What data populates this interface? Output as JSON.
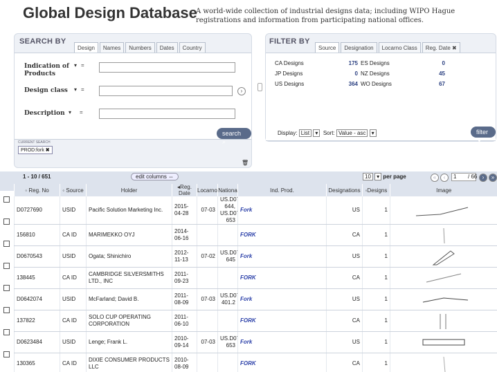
{
  "header": {
    "title": "Global Design Database",
    "tagline": "A world-wide collection of industrial designs data; including WIPO Hague registrations and information from participating national offices."
  },
  "search": {
    "title": "SEARCH BY",
    "tabs": [
      "Design",
      "Names",
      "Numbers",
      "Dates",
      "Country"
    ],
    "fields": [
      {
        "label": "Indication of Products",
        "op": "="
      },
      {
        "label": "Design class",
        "op": "="
      },
      {
        "label": "Description",
        "op": "="
      }
    ],
    "button": "search",
    "current_label": "CURRENT SEARCH",
    "current_tag": "PROD:fork"
  },
  "filter": {
    "title": "FILTER BY",
    "tabs": [
      "Source",
      "Designation",
      "Locarno Class",
      "Reg. Date"
    ],
    "sources": [
      {
        "name": "CA Designs",
        "count": "175"
      },
      {
        "name": "ES Designs",
        "count": "0"
      },
      {
        "name": "JP Designs",
        "count": "0"
      },
      {
        "name": "NZ Designs",
        "count": "45"
      },
      {
        "name": "US Designs",
        "count": "364"
      },
      {
        "name": "WO Designs",
        "count": "67"
      }
    ],
    "display_label": "Display:",
    "display_value": "List",
    "sort_label": "Sort:",
    "sort_value": "Value - asc",
    "button": "filter"
  },
  "results": {
    "range": "1 - 10 / 651",
    "edit_columns": "edit columns",
    "per_page_value": "10",
    "per_page_label": "per page",
    "page": "1",
    "pages": "/ 66"
  },
  "columns": [
    "Reg. No",
    "Source",
    "Holder",
    "Reg. Date",
    "Locarno",
    "Nationa",
    "Ind. Prod.",
    "Designations",
    "Designs",
    "Image"
  ],
  "rows": [
    {
      "reg": "D0727690",
      "src": "USID",
      "holder": "Pacific Solution Marketing Inc.",
      "date": "2015-04-28",
      "loc": "07-03",
      "nat": "US.D07-644, US.D07-653",
      "prod": "Fork",
      "desig": "US",
      "n": "1"
    },
    {
      "reg": "156810",
      "src": "CA ID",
      "holder": "MARIMEKKO OYJ",
      "date": "2014-06-16",
      "loc": "",
      "nat": "",
      "prod": "FORK",
      "desig": "CA",
      "n": "1"
    },
    {
      "reg": "D0670543",
      "src": "USID",
      "holder": "Ogata; Shinichiro",
      "date": "2012-11-13",
      "loc": "07-02",
      "nat": "US.D07-645",
      "prod": "Fork",
      "desig": "US",
      "n": "1"
    },
    {
      "reg": "138445",
      "src": "CA ID",
      "holder": "CAMBRIDGE SILVERSMITHS LTD., INC",
      "date": "2011-09-23",
      "loc": "",
      "nat": "",
      "prod": "FORK",
      "desig": "CA",
      "n": "1"
    },
    {
      "reg": "D0642074",
      "src": "USID",
      "holder": "McFarland; David B.",
      "date": "2011-08-09",
      "loc": "07-03",
      "nat": "US.D07-401.2",
      "prod": "Fork",
      "desig": "US",
      "n": "1"
    },
    {
      "reg": "137822",
      "src": "CA ID",
      "holder": "SOLO CUP OPERATING CORPORATION",
      "date": "2011-06-10",
      "loc": "",
      "nat": "",
      "prod": "FORK",
      "desig": "CA",
      "n": "1"
    },
    {
      "reg": "D0623484",
      "src": "USID",
      "holder": "Lenge; Frank L.",
      "date": "2010-09-14",
      "loc": "07-03",
      "nat": "US.D07-653",
      "prod": "Fork",
      "desig": "US",
      "n": "1"
    },
    {
      "reg": "130365",
      "src": "CA ID",
      "holder": "DIXIE CONSUMER PRODUCTS LLC",
      "date": "2010-08-09",
      "loc": "",
      "nat": "",
      "prod": "FORK",
      "desig": "CA",
      "n": "1"
    }
  ]
}
